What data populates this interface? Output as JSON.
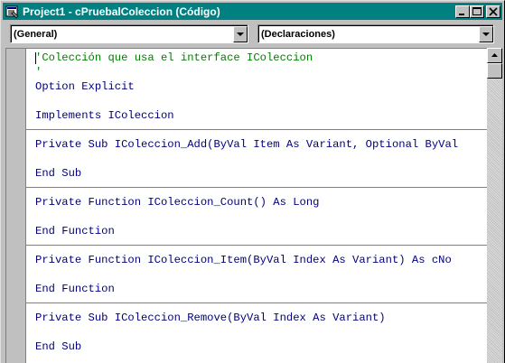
{
  "window": {
    "title": "Project1 - cPruebalColeccion (Código)",
    "title_bar_color": "#008080"
  },
  "title_buttons": [
    {
      "name": "minimize",
      "icon": "minimize-icon"
    },
    {
      "name": "maximize",
      "icon": "maximize-icon"
    },
    {
      "name": "close",
      "icon": "close-icon"
    }
  ],
  "object_combo": {
    "value": "(General)"
  },
  "procedure_combo": {
    "value": "(Declaraciones)"
  },
  "code": {
    "keyword_color": "#00007f",
    "comment_color": "#008000",
    "lines": [
      {
        "text": "'Colección que usa el interface IColeccion",
        "kind": "comment"
      },
      {
        "text": "'",
        "kind": "comment"
      },
      {
        "text": "Option Explicit",
        "kind": "code"
      },
      {
        "text": "",
        "kind": "code"
      },
      {
        "text": "Implements IColeccion",
        "kind": "code"
      },
      {
        "text": "",
        "kind": "code",
        "separator": true
      },
      {
        "text": "Private Sub IColeccion_Add(ByVal Item As Variant, Optional ByVal",
        "kind": "code"
      },
      {
        "text": "",
        "kind": "code"
      },
      {
        "text": "End Sub",
        "kind": "code"
      },
      {
        "text": "",
        "kind": "code",
        "separator": true
      },
      {
        "text": "Private Function IColeccion_Count() As Long",
        "kind": "code"
      },
      {
        "text": "",
        "kind": "code"
      },
      {
        "text": "End Function",
        "kind": "code"
      },
      {
        "text": "",
        "kind": "code",
        "separator": true
      },
      {
        "text": "Private Function IColeccion_Item(ByVal Index As Variant) As cNo",
        "kind": "code"
      },
      {
        "text": "",
        "kind": "code"
      },
      {
        "text": "End Function",
        "kind": "code"
      },
      {
        "text": "",
        "kind": "code",
        "separator": true
      },
      {
        "text": "Private Sub IColeccion_Remove(ByVal Index As Variant)",
        "kind": "code"
      },
      {
        "text": "",
        "kind": "code"
      },
      {
        "text": "End Sub",
        "kind": "code"
      },
      {
        "text": "",
        "kind": "code"
      }
    ]
  },
  "scrollbar": {
    "up_icon": "arrow-up-icon",
    "down_icon": "arrow-down-icon",
    "position": 0
  }
}
